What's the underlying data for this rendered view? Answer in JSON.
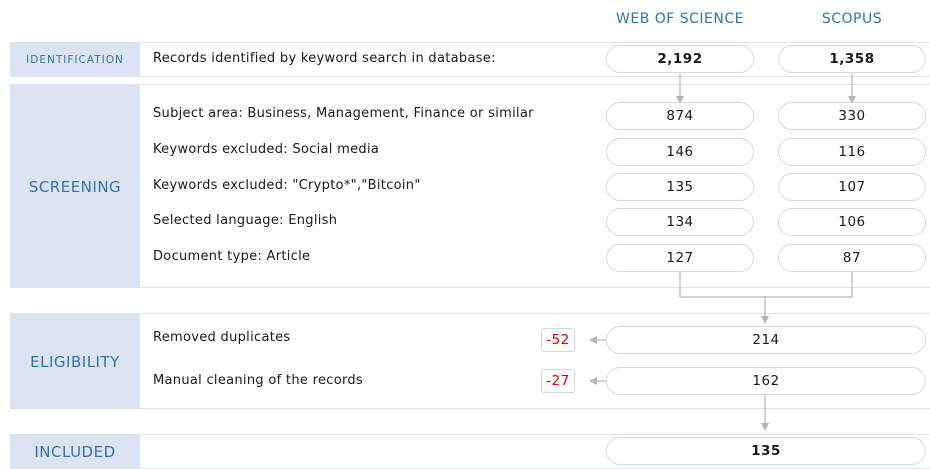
{
  "columns": {
    "wos": "WEB OF SCIENCE",
    "scopus": "SCOPUS"
  },
  "stages": {
    "identification": "IDENTIFICATION",
    "screening": "SCREENING",
    "eligibility": "ELIGIBILITY",
    "included": "INCLUDED"
  },
  "identification": {
    "label": "Records identified by keyword search in database:",
    "wos": "2,192",
    "scopus": "1,358"
  },
  "screening": [
    {
      "label": "Subject area: Business, Management, Finance or similar",
      "wos": "874",
      "scopus": "330"
    },
    {
      "label": "Keywords excluded: Social media",
      "wos": "146",
      "scopus": "116"
    },
    {
      "label": "Keywords excluded: \"Crypto*\",\"Bitcoin\"",
      "wos": "135",
      "scopus": "107"
    },
    {
      "label": "Selected language: English",
      "wos": "134",
      "scopus": "106"
    },
    {
      "label": "Document type: Article",
      "wos": "127",
      "scopus": "87"
    }
  ],
  "eligibility": [
    {
      "label": "Removed duplicates",
      "removed": "-52",
      "value": "214"
    },
    {
      "label": "Manual cleaning of the records",
      "removed": "-27",
      "value": "162"
    }
  ],
  "included": {
    "value": "135"
  },
  "colors": {
    "accent": "#2e75b6",
    "stage_fill": "#dce3f2",
    "removed": "#e00000",
    "connector": "#b7b7b7"
  }
}
